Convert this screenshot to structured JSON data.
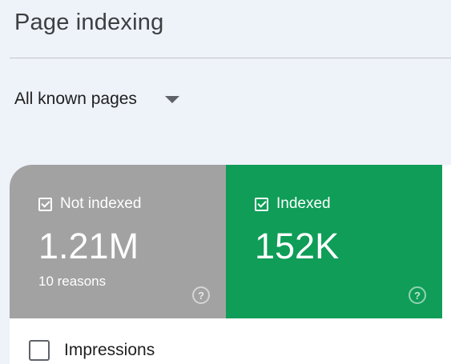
{
  "header": {
    "title": "Page indexing"
  },
  "filter": {
    "selected": "All known pages"
  },
  "cards": {
    "not_indexed": {
      "label": "Not indexed",
      "value": "1.21M",
      "subtext": "10 reasons",
      "checked": true,
      "color": "#a2a2a2"
    },
    "indexed": {
      "label": "Indexed",
      "value": "152K",
      "checked": true,
      "color": "#0f9d58"
    }
  },
  "metrics": {
    "impressions_label": "Impressions",
    "impressions_checked": false
  }
}
